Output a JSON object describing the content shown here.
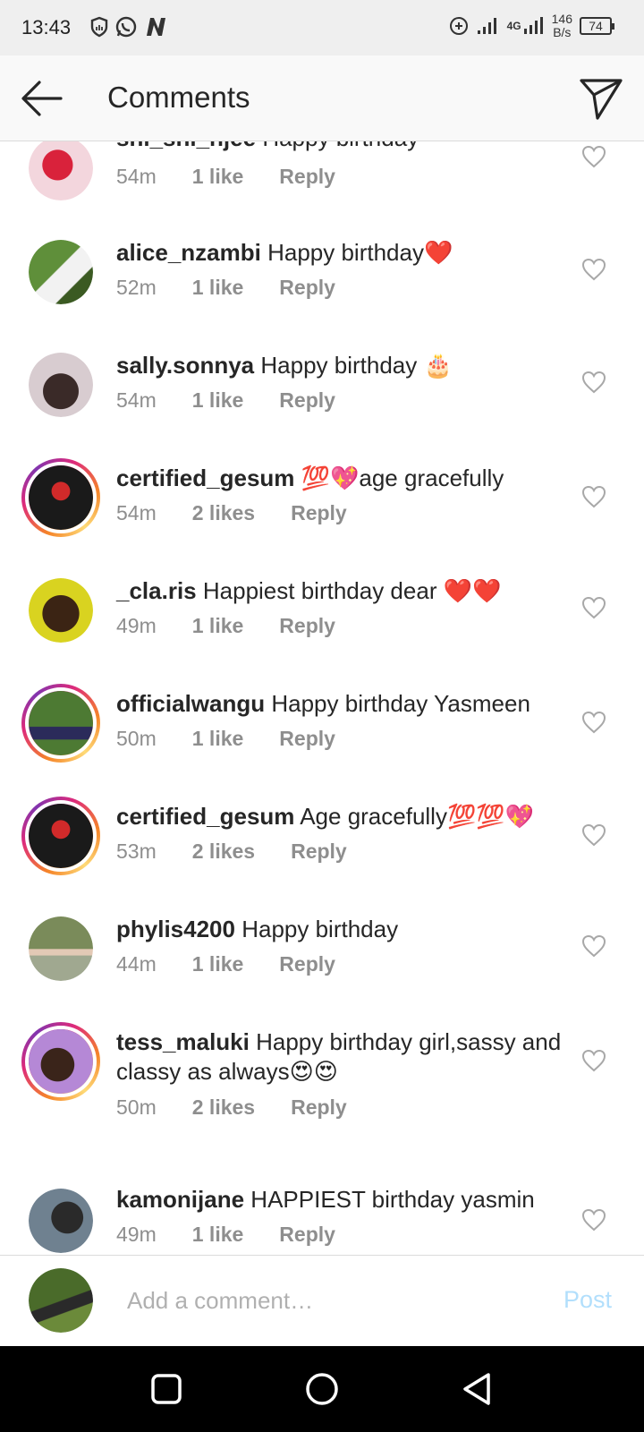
{
  "status_bar": {
    "time": "13:43",
    "left_icons": [
      "shield-icon",
      "whatsapp-icon",
      "n-app-icon"
    ],
    "right_icons": [
      "data-saver-icon",
      "signal-icon",
      "signal-4g-icon"
    ],
    "network_label": "4G",
    "speed_value": "146",
    "speed_unit": "B/s",
    "battery": "74"
  },
  "header": {
    "title": "Comments",
    "back_icon": "arrow-left-icon",
    "share_icon": "paper-plane-icon"
  },
  "comments": [
    {
      "username": "shi_shi_njee",
      "text": "Happy birthday",
      "time": "54m",
      "likes": "1 like",
      "reply": "Reply",
      "story_ring": false,
      "avatar_colors": [
        "#f3d6dd",
        "#d9223b"
      ]
    },
    {
      "username": "alice_nzambi",
      "text": "Happy birthday❤️",
      "time": "52m",
      "likes": "1 like",
      "reply": "Reply",
      "story_ring": false,
      "avatar_colors": [
        "#5f8f3a",
        "#f2f2f2"
      ]
    },
    {
      "username": "sally.sonnya",
      "text": "Happy birthday 🎂",
      "time": "54m",
      "likes": "1 like",
      "reply": "Reply",
      "story_ring": false,
      "avatar_colors": [
        "#d8ccd0",
        "#3a2a28"
      ]
    },
    {
      "username": "certified_gesum",
      "text": "💯💖age gracefully",
      "time": "54m",
      "likes": "2 likes",
      "reply": "Reply",
      "story_ring": true,
      "avatar_colors": [
        "#1a1a1a",
        "#d12a2a"
      ]
    },
    {
      "username": "_cla.ris",
      "text": "Happiest birthday dear ❤️❤️",
      "time": "49m",
      "likes": "1 like",
      "reply": "Reply",
      "story_ring": false,
      "avatar_colors": [
        "#d9d320",
        "#3b2414"
      ]
    },
    {
      "username": "officialwangu",
      "text": "Happy birthday Yasmeen",
      "time": "50m",
      "likes": "1 like",
      "reply": "Reply",
      "story_ring": true,
      "avatar_colors": [
        "#4d7a33",
        "#2b2b5a"
      ]
    },
    {
      "username": "certified_gesum",
      "text": "Age gracefully💯💯💖",
      "time": "53m",
      "likes": "2 likes",
      "reply": "Reply",
      "story_ring": true,
      "avatar_colors": [
        "#1a1a1a",
        "#d12a2a"
      ]
    },
    {
      "username": "phylis4200",
      "text": "Happy birthday",
      "time": "44m",
      "likes": "1 like",
      "reply": "Reply",
      "story_ring": false,
      "avatar_colors": [
        "#7a8b5a",
        "#e3c9b5"
      ]
    },
    {
      "username": "tess_maluki",
      "text": "Happy birthday girl,sassy and classy as always😍😍",
      "time": "50m",
      "likes": "2 likes",
      "reply": "Reply",
      "story_ring": true,
      "avatar_colors": [
        "#b588d6",
        "#3a241a"
      ]
    },
    {
      "username": "kamonijane",
      "text": "HAPPIEST birthday yasmin",
      "time": "49m",
      "likes": "1 like",
      "reply": "Reply",
      "story_ring": false,
      "avatar_colors": [
        "#6f8190",
        "#2a2a2a"
      ]
    }
  ],
  "add_comment": {
    "placeholder": "Add a comment…",
    "post_label": "Post",
    "avatar_colors": [
      "#4a6b2a",
      "#2a2a2a"
    ]
  },
  "nav_bar": {
    "buttons": [
      "recents-square-icon",
      "home-circle-icon",
      "back-triangle-icon"
    ]
  },
  "colors": {
    "post_disabled": "#b2dffc",
    "meta_gray": "#8e8e8e",
    "heart_gray": "#a8a8a8",
    "story_ring": [
      "#f58529",
      "#dd2a7b",
      "#8134af"
    ]
  }
}
